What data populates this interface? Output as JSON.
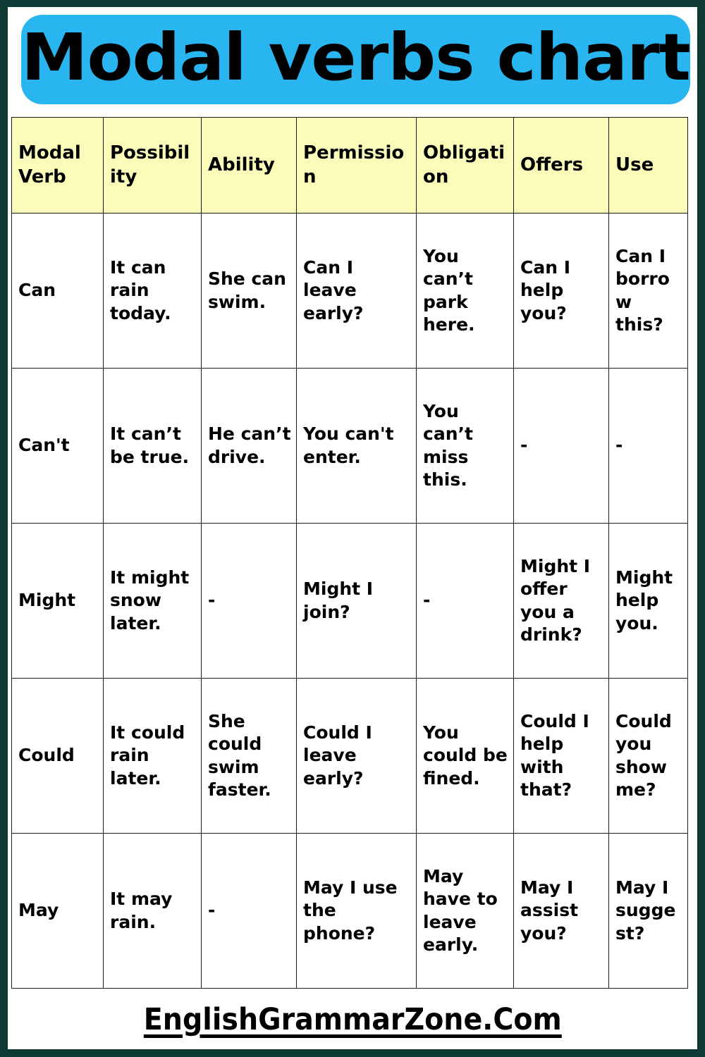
{
  "banner": {
    "title": "Modal verbs chart",
    "background_color": "#29b6f0",
    "text_color": "#000000"
  },
  "frame": {
    "border_color": "#0d3b33",
    "page_background": "#ffffff"
  },
  "table": {
    "header_background": "#fbfbba",
    "grid_color": "#1a1a1a",
    "headers": [
      "Modal Verb",
      "Possibility",
      "Ability",
      "Permission",
      "Obligation",
      "Offers",
      "Use"
    ],
    "rows": [
      {
        "verb": "Can",
        "possibility": "It can rain today.",
        "ability": "She can swim.",
        "permission": "Can I leave early?",
        "obligation": "You can’t park here.",
        "offers": "Can I help you?",
        "use": "Can I borrow this?"
      },
      {
        "verb": "Can't",
        "possibility": "It can’t be true.",
        "ability": "He can’t drive.",
        "permission": "You can't enter.",
        "obligation": "You can’t miss this.",
        "offers": "-",
        "use": "-"
      },
      {
        "verb": "Might",
        "possibility": "It might snow later.",
        "ability": "-",
        "permission": "Might I join?",
        "obligation": "-",
        "offers": "Might I offer you a drink?",
        "use": "Might help you."
      },
      {
        "verb": "Could",
        "possibility": "It could rain later.",
        "ability": "She could swim faster.",
        "permission": "Could I leave early?",
        "obligation": "You could be fined.",
        "offers": "Could I help with that?",
        "use": "Could you show me?"
      },
      {
        "verb": "May",
        "possibility": "It may rain.",
        "ability": "-",
        "permission": "May I use the phone?",
        "obligation": "May have to leave early.",
        "offers": "May I assist you?",
        "use": "May I suggest?"
      }
    ]
  },
  "footer": {
    "website": "EnglishGrammarZone.Com"
  }
}
